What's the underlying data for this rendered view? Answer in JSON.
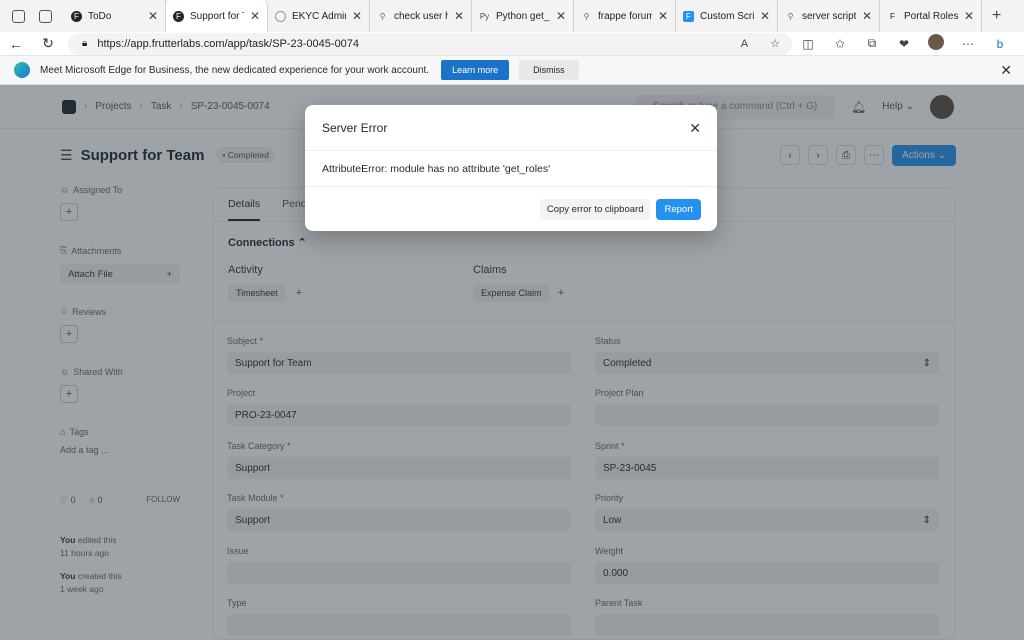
{
  "browser": {
    "tabs": [
      {
        "label": "ToDo",
        "icon": "frappe-icon"
      },
      {
        "label": "Support for Te",
        "icon": "frappe-icon",
        "active": true
      },
      {
        "label": "EKYC Admin",
        "icon": "loading-icon"
      },
      {
        "label": "check user ha",
        "icon": "search-icon"
      },
      {
        "label": "Python get_r",
        "icon": "py-icon"
      },
      {
        "label": "frappe forum",
        "icon": "search-icon"
      },
      {
        "label": "Custom Scrip",
        "icon": "f-icon"
      },
      {
        "label": "server script",
        "icon": "search-icon"
      },
      {
        "label": "Portal Roles",
        "icon": "f-icon"
      }
    ],
    "url": "https://app.frutterlabs.com/app/task/SP-23-0045-0074",
    "infobar": {
      "message": "Meet Microsoft Edge for Business, the new dedicated experience for your work account.",
      "learn_more": "Learn more",
      "dismiss": "Dismiss"
    }
  },
  "app": {
    "breadcrumb": [
      "Projects",
      "Task",
      "SP-23-0045-0074"
    ],
    "search_placeholder": "Search or type a command (Ctrl + G)",
    "help": "Help",
    "title": "Support for Team",
    "status": "Completed",
    "actions": "Actions",
    "sidebar": {
      "assigned_to": "Assigned To",
      "attachments": "Attachments",
      "attach_file": "Attach File",
      "reviews": "Reviews",
      "shared_with": "Shared With",
      "tags": "Tags",
      "add_tag": "Add a tag ...",
      "likes": "0",
      "comments": "0",
      "follow": "FOLLOW",
      "activity": [
        {
          "who": "You",
          "what": "edited this",
          "when": "11 hours ago"
        },
        {
          "who": "You",
          "what": "created this",
          "when": "1 week ago"
        }
      ]
    },
    "tabs": [
      "Details",
      "Pending"
    ],
    "connections": "Connections",
    "activity_h": "Activity",
    "claims_h": "Claims",
    "timesheet": "Timesheet",
    "expense_claim": "Expense Claim",
    "fields": {
      "subject": {
        "label": "Subject *",
        "value": "Support for Team"
      },
      "status": {
        "label": "Status",
        "value": "Completed"
      },
      "project": {
        "label": "Project",
        "value": "PRO-23-0047"
      },
      "project_plan": {
        "label": "Project Plan",
        "value": ""
      },
      "task_category": {
        "label": "Task Category *",
        "value": "Support"
      },
      "sprint": {
        "label": "Sprint *",
        "value": "SP-23-0045"
      },
      "task_module": {
        "label": "Task Module *",
        "value": "Support"
      },
      "priority": {
        "label": "Priority",
        "value": "Low"
      },
      "issue": {
        "label": "Issue",
        "value": ""
      },
      "weight": {
        "label": "Weight",
        "value": "0.000"
      },
      "type": {
        "label": "Type",
        "value": ""
      },
      "parent_task": {
        "label": "Parent Task",
        "value": ""
      }
    }
  },
  "modal": {
    "title": "Server Error",
    "message": "AttributeError: module has no attribute 'get_roles'",
    "copy": "Copy error to clipboard",
    "report": "Report"
  }
}
